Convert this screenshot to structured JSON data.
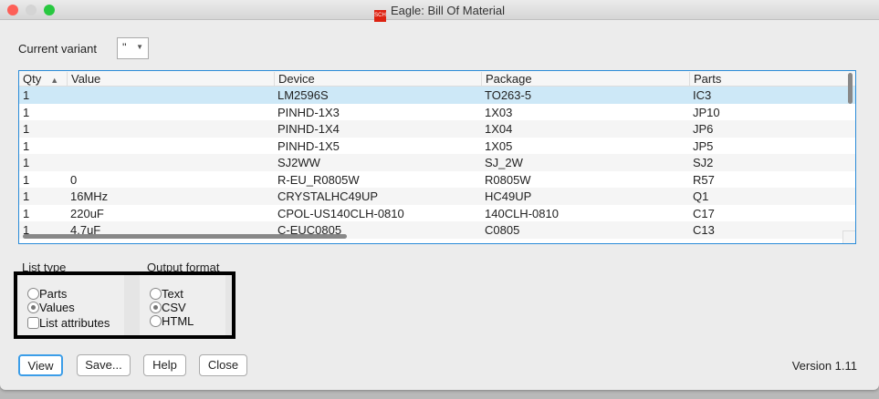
{
  "window": {
    "title": "Eagle: Bill Of Material",
    "title_icon": "SCH"
  },
  "variant": {
    "label": "Current variant",
    "value": "''"
  },
  "table": {
    "columns": [
      "Qty",
      "Value",
      "Device",
      "Package",
      "Parts"
    ],
    "sort_indicator": "▲",
    "rows": [
      [
        "1",
        "",
        "LM2596S",
        "TO263-5",
        "IC3"
      ],
      [
        "1",
        "",
        "PINHD-1X3",
        "1X03",
        "JP10"
      ],
      [
        "1",
        "",
        "PINHD-1X4",
        "1X04",
        "JP6"
      ],
      [
        "1",
        "",
        "PINHD-1X5",
        "1X05",
        "JP5"
      ],
      [
        "1",
        "",
        "SJ2WW",
        "SJ_2W",
        "SJ2"
      ],
      [
        "1",
        "0",
        "R-EU_R0805W",
        "R0805W",
        "R57"
      ],
      [
        "1",
        "16MHz",
        "CRYSTALHC49UP",
        "HC49UP",
        "Q1"
      ],
      [
        "1",
        "220uF",
        "CPOL-US140CLH-0810",
        "140CLH-0810",
        "C17"
      ],
      [
        "1",
        "4.7uF",
        "C-EUC0805",
        "C0805",
        "C13"
      ]
    ]
  },
  "list_type": {
    "label": "List type",
    "options": [
      "Parts",
      "Values",
      "List attributes"
    ],
    "selected": "Values",
    "list_attributes_checked": false
  },
  "output_format": {
    "label": "Output format",
    "options": [
      "Text",
      "CSV",
      "HTML"
    ],
    "selected": "CSV"
  },
  "buttons": {
    "view": "View",
    "save": "Save...",
    "help": "Help",
    "close": "Close"
  },
  "version": "Version 1.11"
}
